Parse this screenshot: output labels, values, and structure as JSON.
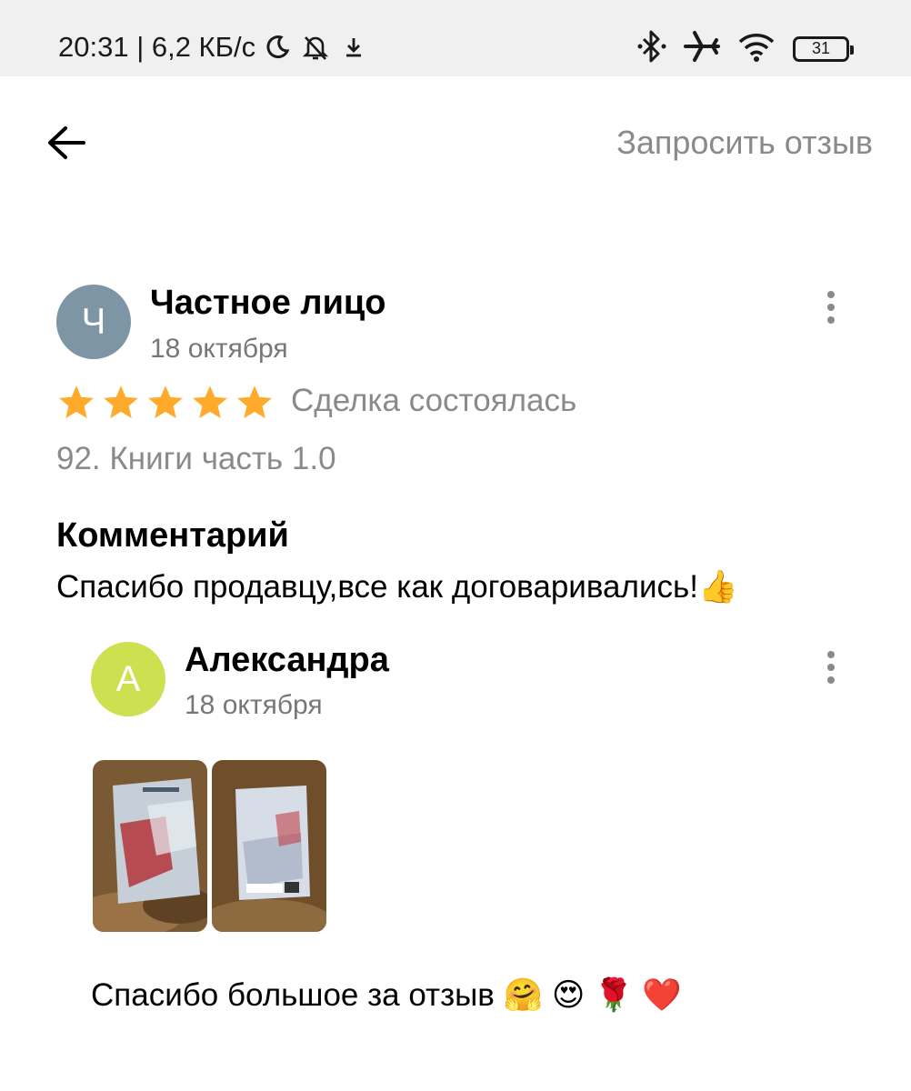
{
  "status_bar": {
    "time_speed": "20:31 | 6,2 КБ/с",
    "battery": "31"
  },
  "toolbar": {
    "back_icon": "arrow-left-icon",
    "request_review": "Запросить отзыв"
  },
  "review": {
    "avatar_letter": "Ч",
    "avatar_color": "#7d95a5",
    "author": "Частное лицо",
    "date": "18 октября",
    "rating": 5,
    "rating_max": 5,
    "star_color": "#ffaa2b",
    "deal_status": "Сделка состоялась",
    "item": "92. Книги часть 1.0",
    "comment_heading": "Комментарий",
    "comment_text": "Спасибо продавцу,все как договаривались!👍"
  },
  "reply": {
    "avatar_letter": "А",
    "avatar_color": "#cde050",
    "author": "Александра",
    "date": "18 октября",
    "photos": [
      "book-front-photo",
      "book-back-photo"
    ],
    "text": "Спасибо большое за отзыв 🤗 😍 🌹 ❤️"
  }
}
